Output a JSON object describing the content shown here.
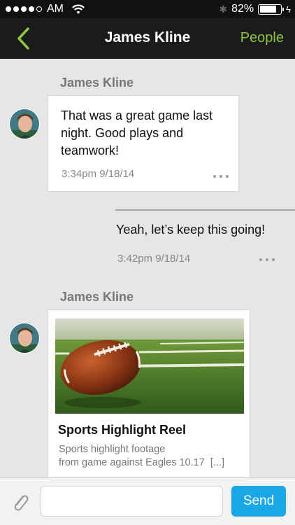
{
  "status_bar": {
    "carrier": "AM",
    "battery": "82%",
    "battery_level": 0.82
  },
  "nav": {
    "title": "James Kline",
    "right_label": "People"
  },
  "messages": [
    {
      "sender": "James Kline",
      "text": "That was a great game last night. Good plays and teamwork!",
      "time": "3:34pm 9/18/14"
    },
    {
      "text": "Yeah, let’s keep this going!",
      "time": "3:42pm 9/18/14"
    },
    {
      "sender": "James Kline",
      "card_title": "Sports Highlight Reel",
      "card_desc_line1": "Sports highlight footage",
      "card_desc_line2": "from game against Eagles 10.17",
      "card_more": "[...]"
    }
  ],
  "composer": {
    "placeholder": "",
    "send_label": "Send"
  },
  "colors": {
    "accent_green": "#8dc63f",
    "send_blue": "#1aa7e8",
    "navbar": "#1b1b1b"
  }
}
